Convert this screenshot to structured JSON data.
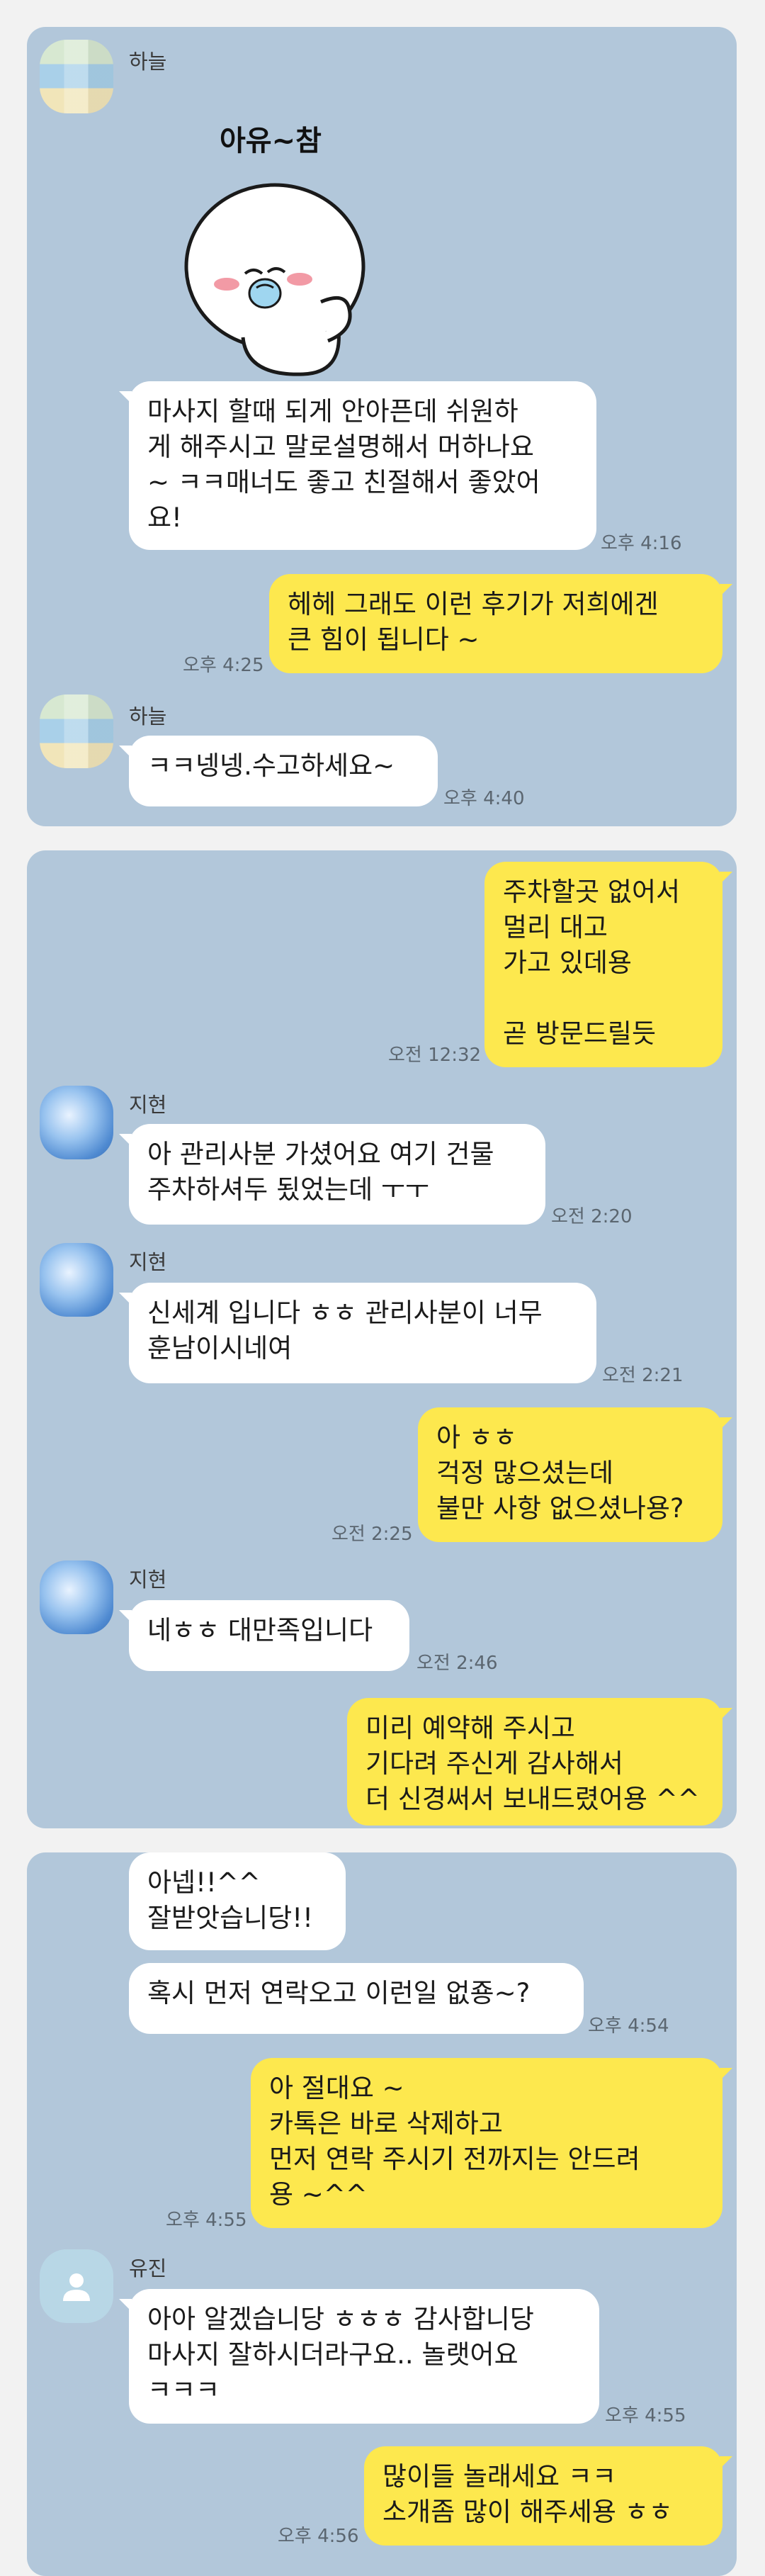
{
  "panels": [
    {
      "sender": "하늘",
      "sticker_text": "아유~참",
      "msg1": "마사지 할때 되게 안아픈데 쉬원하\n게 해주시고 말로설명해서 머하나요\n~ ㅋㅋ매너도 좋고 친절해서 좋았어\n요!",
      "msg1_time": "오후 4:16",
      "reply": "헤헤 그래도 이런 후기가 저희에겐\n큰 힘이 됩니다 ~",
      "reply_time": "오후 4:25",
      "sender2": "하늘",
      "msg2": "ㅋㅋ넹넹.수고하세요~",
      "msg2_time": "오후 4:40"
    },
    {
      "out1": "주차할곳 없어서\n멀리 대고\n가고 있데용\n\n곧 방문드릴듯",
      "out1_time": "오전 12:32",
      "sender": "지현",
      "in1": "아 관리사분 가셨어요 여기 건물\n주차하셔두 됬었는데 ㅜㅜ",
      "in1_time": "오전 2:20",
      "sender2": "지현",
      "in2": "신세계 입니다 ㅎㅎ 관리사분이 너무\n훈남이시네여",
      "in2_time": "오전 2:21",
      "out2": "아 ㅎㅎ\n걱정 많으셨는데\n불만 사항 없으셨나용?",
      "out2_time": "오전 2:25",
      "sender3": "지현",
      "in3": "네ㅎㅎ 대만족입니다",
      "in3_time": "오전 2:46",
      "out3": "미리 예약해 주시고\n기다려 주신게 감사해서\n더 신경써서 보내드렸어용 ^^"
    },
    {
      "in1": "아넵!!^^\n잘받앗습니당!!",
      "in2": "혹시 먼저 연락오고 이런일 없죵~?",
      "in2_time": "오후 4:54",
      "out1": "아 절대요 ~\n카톡은 바로 삭제하고\n먼저 연락 주시기 전까지는 안드려\n용 ~^^",
      "out1_time": "오후 4:55",
      "sender": "유진",
      "in3": "아아 알겠습니당 ㅎㅎㅎ 감사합니당\n마사지 잘하시더라구요.. 놀랫어요\nㅋㅋㅋ",
      "in3_time": "오후 4:55",
      "out2": "많이들 놀래세요 ㅋㅋ\n소개좀 많이 해주세용 ㅎㅎ",
      "out2_time": "오후 4:56"
    }
  ],
  "colors": {
    "chat_bg": "#b2c7da",
    "outgoing": "#fde84e",
    "incoming": "#ffffff"
  },
  "icons": {
    "default_avatar": "person-icon"
  }
}
